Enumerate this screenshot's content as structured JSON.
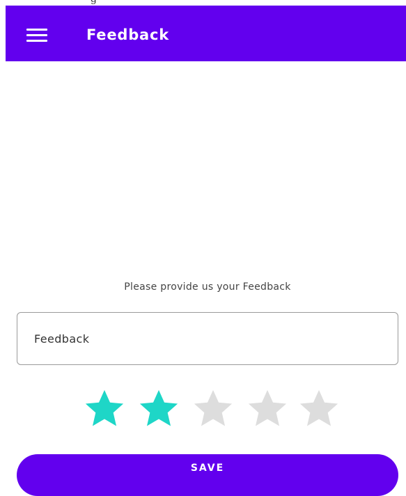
{
  "app_bar": {
    "title": "Feedback",
    "menu_icon": "hamburger-menu-icon",
    "background": "#6200EE"
  },
  "form": {
    "prompt": "Please provide us your Feedback",
    "feedback_placeholder": "Feedback",
    "feedback_value": ""
  },
  "rating": {
    "value": 2,
    "max": 5,
    "filled_color": "#1ED6C7",
    "empty_color": "#DDDDDD"
  },
  "actions": {
    "save_label": "SAVE",
    "accent": "#6200EE"
  }
}
